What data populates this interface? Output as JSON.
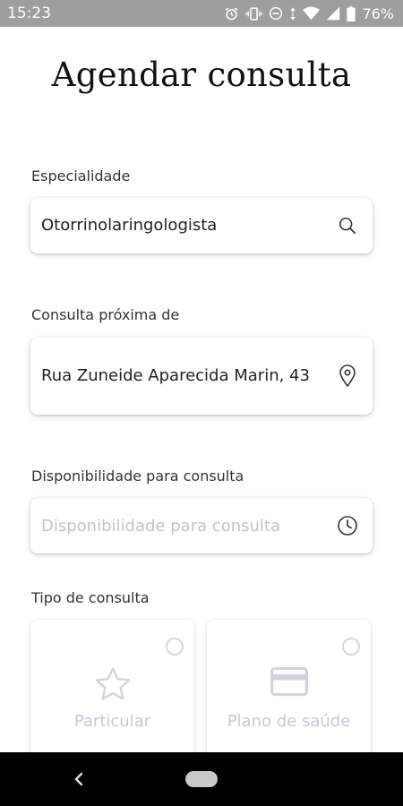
{
  "status_bar": {
    "time": "15:23",
    "battery": "76%",
    "icons": [
      "alarm-icon",
      "vibrate-icon",
      "dnd-icon",
      "data-arrows-icon",
      "wifi-icon",
      "signal-icon",
      "battery-icon"
    ]
  },
  "page": {
    "title": "Agendar consulta"
  },
  "specialty": {
    "label": "Especialidade",
    "value": "Otorrinolaringologista",
    "icon": "search-icon"
  },
  "location": {
    "label": "Consulta próxima de",
    "value": "Rua Zuneide Aparecida Marin, 43",
    "icon": "location-pin-icon"
  },
  "availability": {
    "label": "Disponibilidade para consulta",
    "placeholder": "Disponibilidade para consulta",
    "icon": "clock-icon"
  },
  "consult_type": {
    "label": "Tipo de consulta",
    "options": [
      {
        "label": "Particular",
        "icon": "star-icon"
      },
      {
        "label": "Plano de saúde",
        "icon": "credit-card-icon"
      }
    ]
  },
  "colors": {
    "status_bar": "#9e9e9e",
    "placeholder": "#c4c4cc",
    "disabled_option": "#c8c8da"
  }
}
